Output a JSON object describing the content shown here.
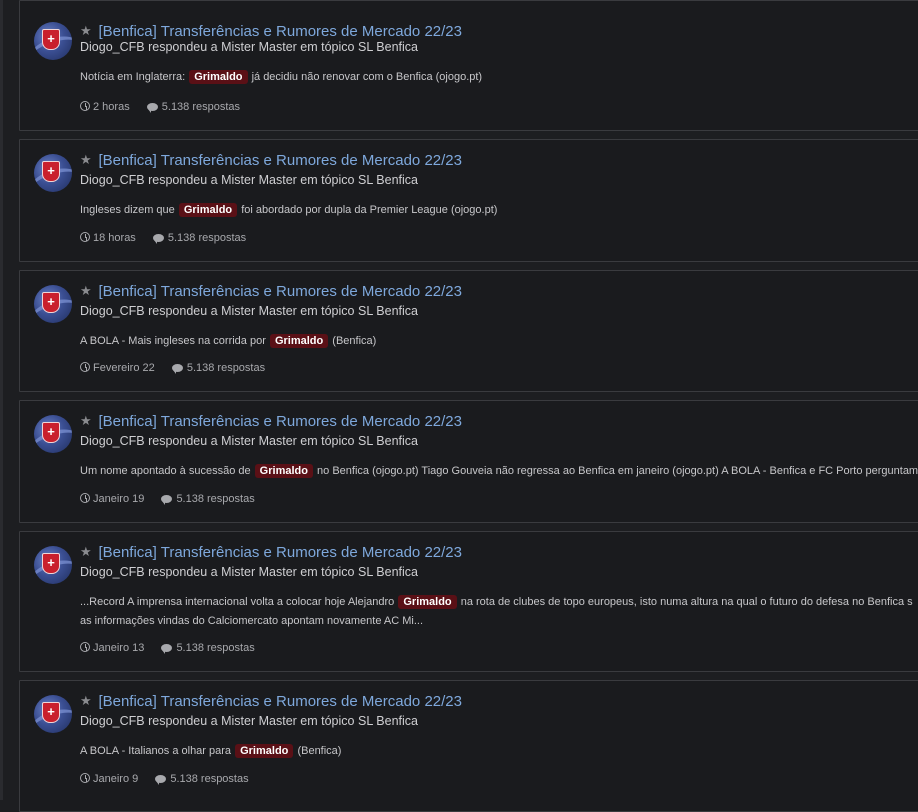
{
  "results": [
    {
      "title": "[Benfica] Transferências e Rumores de Mercado 22/23",
      "author": "Diogo_CFB",
      "action": "respondeu a",
      "target": "Mister Master",
      "in_text": "em tópico",
      "forum": "SL Benfica",
      "snippet_before": "Notícia em Inglaterra: ",
      "highlight": "Grimaldo",
      "snippet_after": " já decidiu não renovar com o Benfica (ojogo.pt)",
      "time": "2 horas",
      "replies": "5.138 respostas"
    },
    {
      "title": "[Benfica] Transferências e Rumores de Mercado 22/23",
      "author": "Diogo_CFB",
      "action": "respondeu a",
      "target": "Mister Master",
      "in_text": "em tópico",
      "forum": "SL Benfica",
      "snippet_before": "Ingleses dizem que ",
      "highlight": "Grimaldo",
      "snippet_after": " foi abordado por dupla da Premier League (ojogo.pt)",
      "time": "18 horas",
      "replies": "5.138 respostas"
    },
    {
      "title": "[Benfica] Transferências e Rumores de Mercado 22/23",
      "author": "Diogo_CFB",
      "action": "respondeu a",
      "target": "Mister Master",
      "in_text": "em tópico",
      "forum": "SL Benfica",
      "snippet_before": "A BOLA - Mais ingleses na corrida por ",
      "highlight": "Grimaldo",
      "snippet_after": " (Benfica)",
      "time": "Fevereiro 22",
      "replies": "5.138 respostas"
    },
    {
      "title": "[Benfica] Transferências e Rumores de Mercado 22/23",
      "author": "Diogo_CFB",
      "action": "respondeu a",
      "target": "Mister Master",
      "in_text": "em tópico",
      "forum": "SL Benfica",
      "snippet_before": "Um nome apontado à sucessão de ",
      "highlight": "Grimaldo",
      "snippet_after": " no Benfica (ojogo.pt) Tiago Gouveia não regressa ao Benfica em janeiro (ojogo.pt) A BOLA - Benfica e FC Porto perguntam",
      "time": "Janeiro 19",
      "replies": "5.138 respostas"
    },
    {
      "title": "[Benfica] Transferências e Rumores de Mercado 22/23",
      "author": "Diogo_CFB",
      "action": "respondeu a",
      "target": "Mister Master",
      "in_text": "em tópico",
      "forum": "SL Benfica",
      "snippet_before": "...Record A imprensa internacional volta a colocar hoje Alejandro ",
      "highlight": "Grimaldo",
      "snippet_after": " na rota de clubes de topo europeus, isto numa altura na qual o futuro do defesa no Benfica s as informações vindas do Calciomercato apontam novamente AC Mi...",
      "time": "Janeiro 13",
      "replies": "5.138 respostas"
    },
    {
      "title": "[Benfica] Transferências e Rumores de Mercado 22/23",
      "author": "Diogo_CFB",
      "action": "respondeu a",
      "target": "Mister Master",
      "in_text": "em tópico",
      "forum": "SL Benfica",
      "snippet_before": "A BOLA - Italianos a olhar para ",
      "highlight": "Grimaldo",
      "snippet_after": " (Benfica)",
      "time": "Janeiro 9",
      "replies": "5.138 respostas"
    }
  ],
  "icons": {
    "star": "star-icon",
    "clock": "clock-icon",
    "replies": "comment-icon",
    "avatar_badge": "benfica-crest"
  }
}
